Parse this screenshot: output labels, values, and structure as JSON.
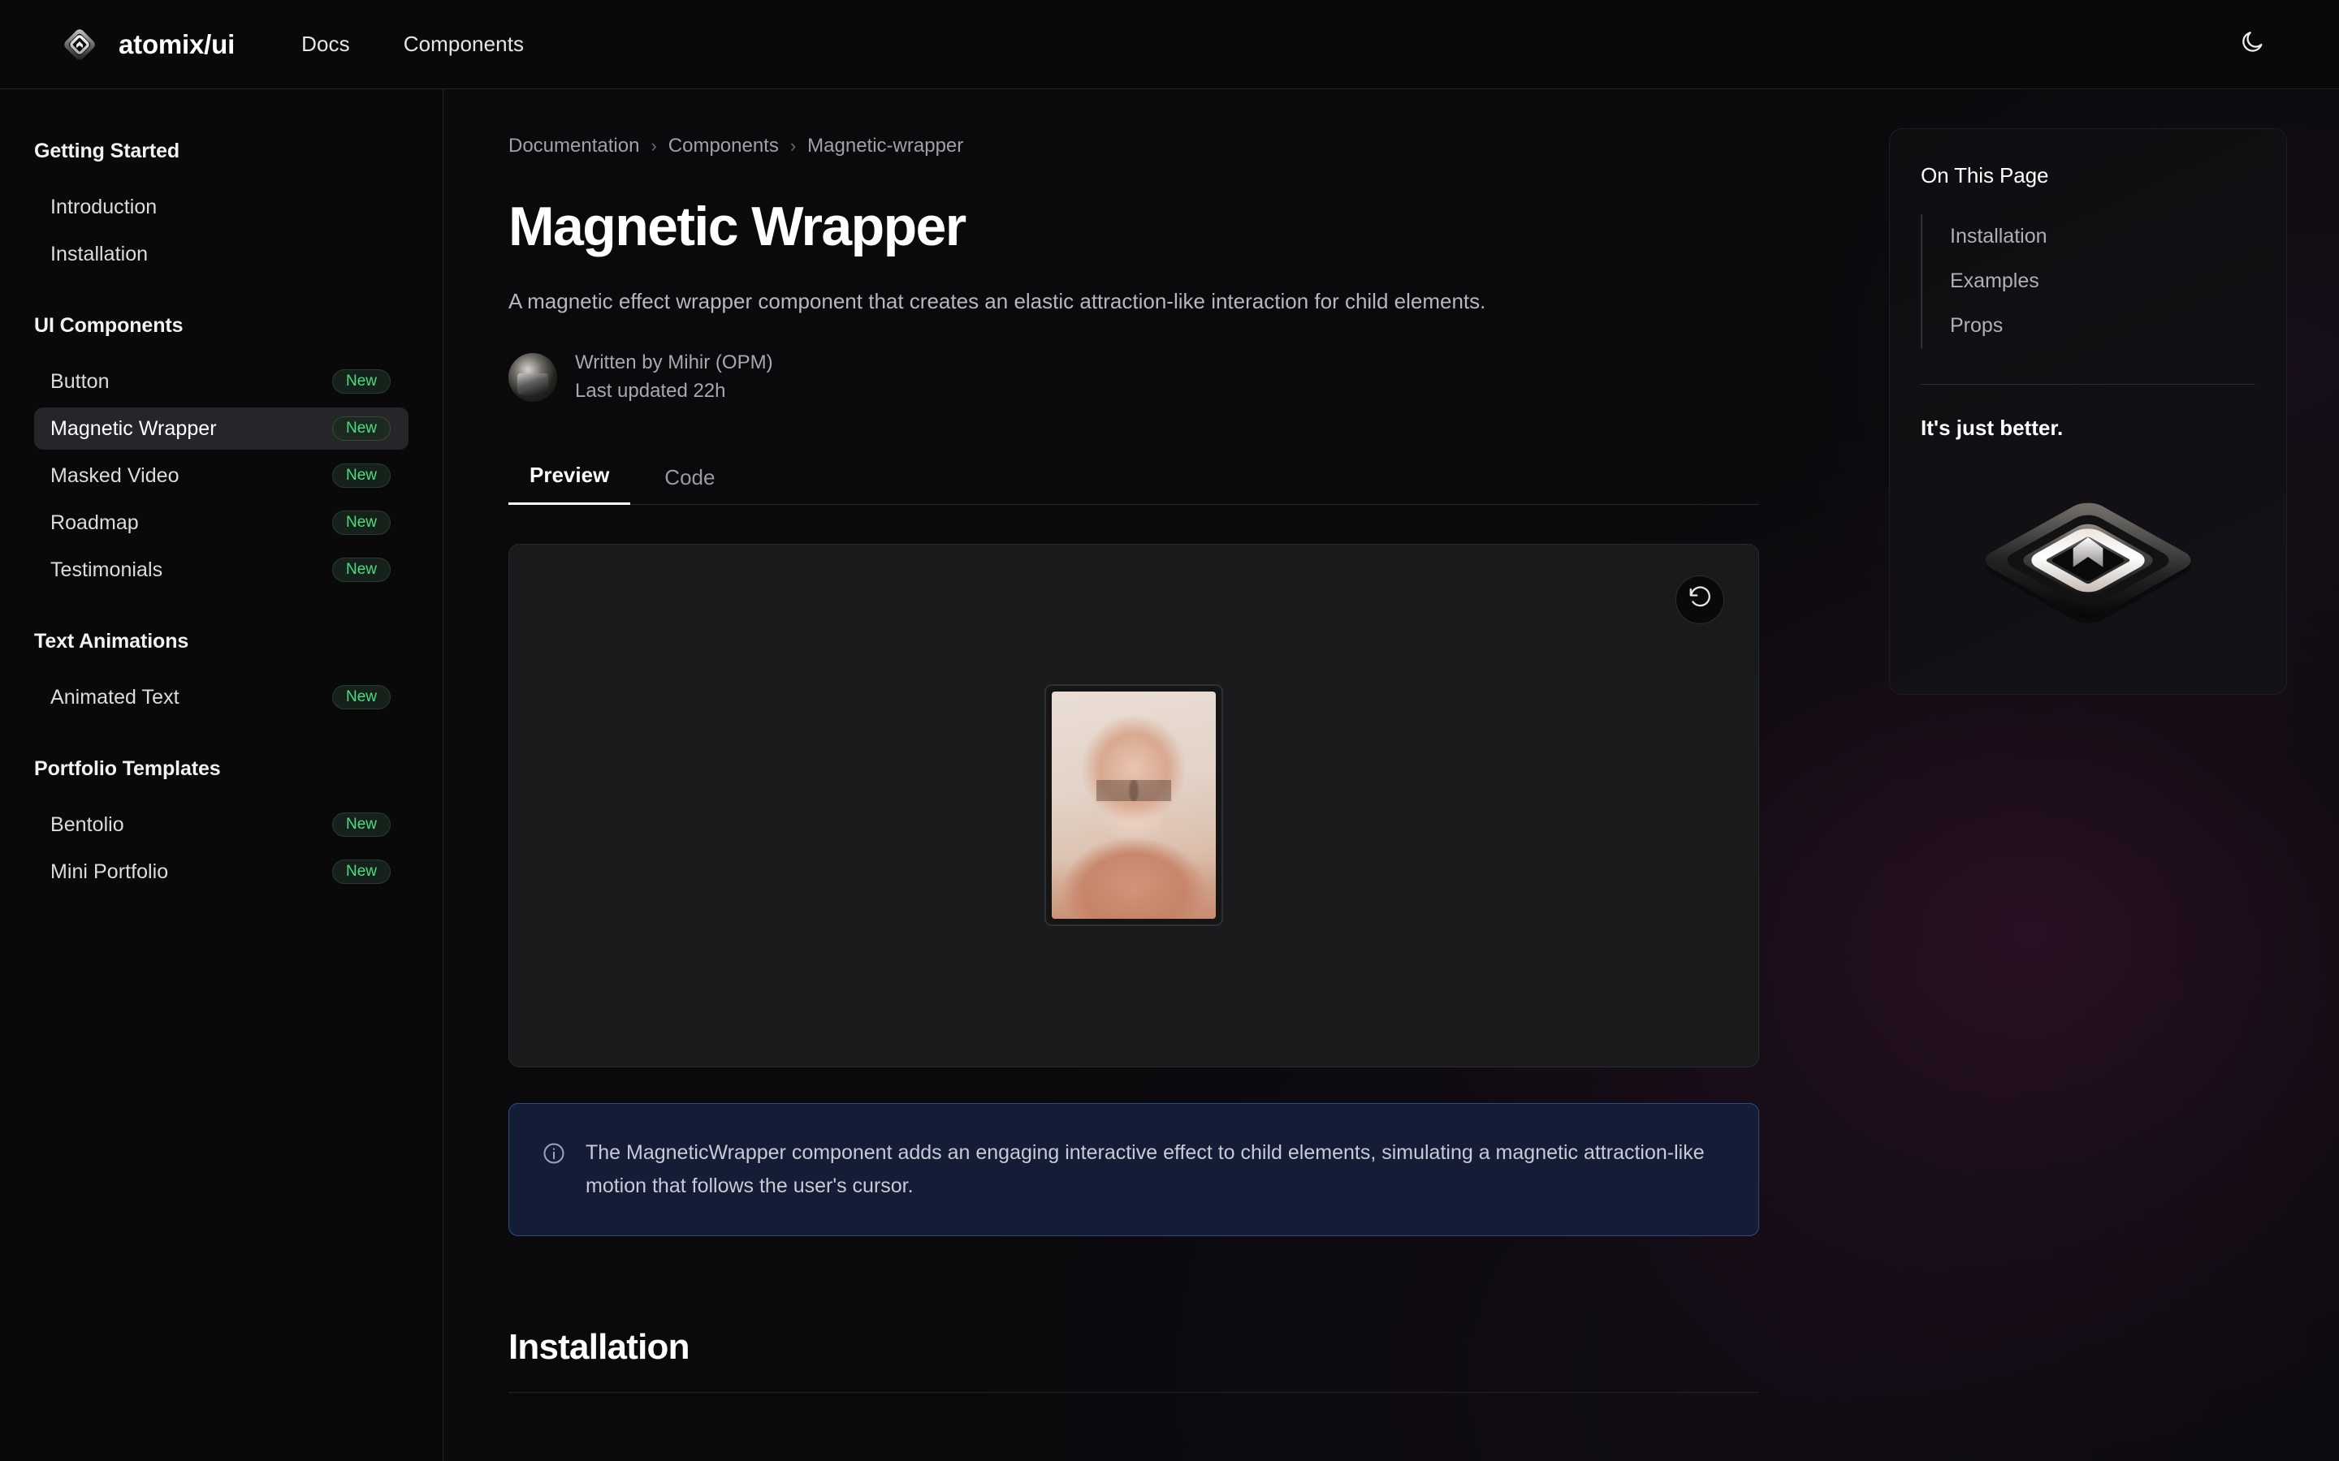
{
  "header": {
    "brand_name": "atomix/ui",
    "brand_icon": "atomix-diamond-logo-icon",
    "nav": [
      {
        "label": "Docs"
      },
      {
        "label": "Components"
      }
    ],
    "theme_toggle_icon": "moon-icon"
  },
  "sidebar": {
    "groups": [
      {
        "title": "Getting Started",
        "items": [
          {
            "label": "Introduction",
            "badge": null,
            "active": false
          },
          {
            "label": "Installation",
            "badge": null,
            "active": false
          }
        ]
      },
      {
        "title": "UI Components",
        "items": [
          {
            "label": "Button",
            "badge": "New",
            "active": false
          },
          {
            "label": "Magnetic Wrapper",
            "badge": "New",
            "active": true
          },
          {
            "label": "Masked Video",
            "badge": "New",
            "active": false
          },
          {
            "label": "Roadmap",
            "badge": "New",
            "active": false
          },
          {
            "label": "Testimonials",
            "badge": "New",
            "active": false
          }
        ]
      },
      {
        "title": "Text Animations",
        "items": [
          {
            "label": "Animated Text",
            "badge": "New",
            "active": false
          }
        ]
      },
      {
        "title": "Portfolio Templates",
        "items": [
          {
            "label": "Bentolio",
            "badge": "New",
            "active": false
          },
          {
            "label": "Mini Portfolio",
            "badge": "New",
            "active": false
          }
        ]
      }
    ]
  },
  "main": {
    "breadcrumb": [
      {
        "label": "Documentation"
      },
      {
        "label": "Components"
      },
      {
        "label": "Magnetic-wrapper"
      }
    ],
    "breadcrumb_separator": "›",
    "title": "Magnetic Wrapper",
    "subtitle": "A magnetic effect wrapper component that creates an elastic attraction-like interaction for child elements.",
    "author": {
      "avatar_icon": "author-avatar",
      "written_by": "Written by Mihir (OPM)",
      "last_updated": "Last updated 22h"
    },
    "tabs": [
      {
        "label": "Preview",
        "active": true
      },
      {
        "label": "Code",
        "active": false
      }
    ],
    "preview": {
      "reset_icon": "rotate-ccw-icon",
      "photo_icon": "portrait-photo"
    },
    "callout": {
      "icon": "info-circle-icon",
      "text": "The MagneticWrapper component adds an engaging interactive effect to child elements, simulating a magnetic attraction-like motion that follows the user's cursor."
    },
    "section_installation_title": "Installation"
  },
  "right_rail": {
    "toc_title": "On This Page",
    "toc_items": [
      {
        "label": "Installation"
      },
      {
        "label": "Examples"
      },
      {
        "label": "Props"
      }
    ],
    "promo_title": "It's just better.",
    "promo_art_icon": "atomix-3d-logo-icon"
  },
  "colors": {
    "page_background": "#0a0a0c",
    "surface": "#09090a",
    "border": "#232327",
    "text_primary": "#ffffff",
    "text_muted": "#a0a0a6",
    "badge_green": "#4ade80",
    "callout_background": "#151c35",
    "callout_border": "#2f4a86",
    "accent_glow_purple": "#6e1e5f",
    "preview_background": "#191a1c"
  }
}
